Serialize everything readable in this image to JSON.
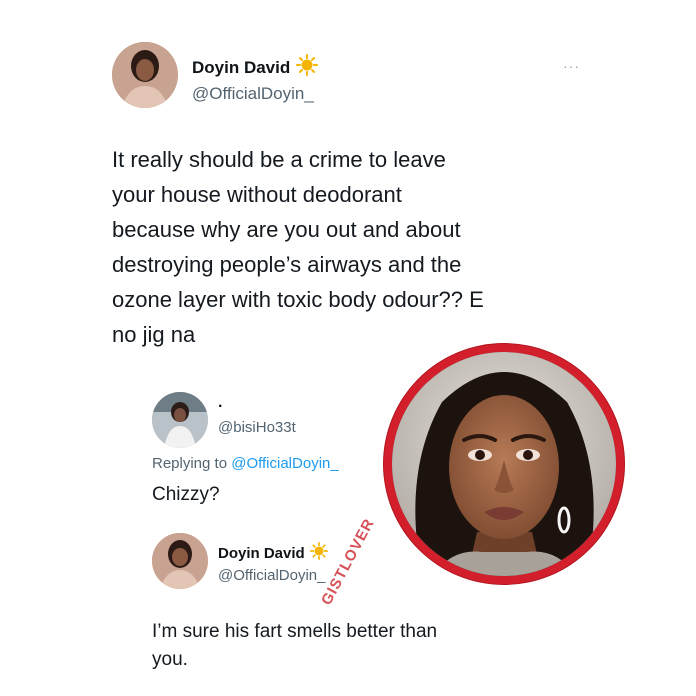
{
  "main_tweet": {
    "author_name": "Doyin David",
    "author_handle": "@OfficialDoyin_",
    "more_label": "···",
    "text_lines": [
      "It really should be a crime to leave",
      "your house without deodorant",
      "because why are you out and about",
      "destroying people’s airways and the",
      "ozone layer with toxic body odour?? E",
      "no jig na"
    ]
  },
  "reply_one": {
    "author_name": ".",
    "author_handle": "@bisiHo33t",
    "replying_prefix": "Replying to",
    "replying_handle": "@OfficialDoyin_",
    "text": "Chizzy?"
  },
  "reply_two": {
    "author_name": "Doyin David",
    "author_handle": "@OfficialDoyin_",
    "text_lines": [
      "I’m sure his fart smells better than",
      "you."
    ]
  },
  "watermark": "GISTLOVER",
  "colors": {
    "text": "#0f1419",
    "muted": "#536471",
    "link": "#1d9bf0",
    "ring": "#d21f2b",
    "sun": "#f4b400"
  },
  "icons": [
    "sun-emoji-icon",
    "more-options-icon"
  ]
}
